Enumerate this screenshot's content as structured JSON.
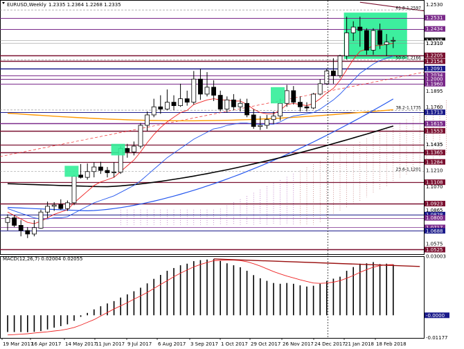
{
  "header": {
    "symbol_text": "EURUSD,Weekly",
    "ohlc_text": "1.2335 1.2364 1.2268 1.2335"
  },
  "colors": {
    "background": "#ffffff",
    "candle_up": "#ffffff",
    "candle_down": "#000000",
    "highlight_box": "#33ee99",
    "ema_red": "#ee2222",
    "ema_blue": "#2255ee",
    "ema_black": "#000000",
    "ema_orange": "#ff9900",
    "level_dark": "#7a1030",
    "level_purple": "#7a2a8a",
    "level_navy": "#1a1a8a",
    "level_gray": "#888888",
    "ichimoku_red": "#b05050",
    "ichimoku_purple": "#9a3aaa",
    "macd_signal": "#ee2222",
    "macd_trendline": "#9a1010",
    "current_tag": "#111111"
  },
  "chart_data": [
    {
      "type": "candlestick",
      "title": "EURUSD,Weekly",
      "ylim": [
        1.048,
        1.266
      ],
      "price_axis_ticks": [
        "1.2530",
        "1.2310",
        "1.1895",
        "1.1760",
        "1.1435",
        "1.1210",
        "1.1070",
        "1.0865",
        "1.0575"
      ],
      "date_labels": [
        "19 Mar 2017",
        "16 Apr 2017",
        "14 May 2017",
        "11 Jun 2017",
        "9 Jul 2017",
        "6 Aug 2017",
        "3 Sep 2017",
        "1 Oct 2017",
        "29 Oct 2017",
        "26 Nov 2017",
        "24 Dec 2017",
        "21 Jan 2018",
        "18 Feb 2018"
      ],
      "candles": [
        {
          "o": 1.076,
          "h": 1.083,
          "l": 1.069,
          "c": 1.08
        },
        {
          "o": 1.08,
          "h": 1.082,
          "l": 1.072,
          "c": 1.0735
        },
        {
          "o": 1.0735,
          "h": 1.078,
          "l": 1.064,
          "c": 1.069
        },
        {
          "o": 1.069,
          "h": 1.072,
          "l": 1.0625,
          "c": 1.066
        },
        {
          "o": 1.066,
          "h": 1.078,
          "l": 1.064,
          "c": 1.0715
        },
        {
          "o": 1.071,
          "h": 1.087,
          "l": 1.0705,
          "c": 1.085
        },
        {
          "o": 1.085,
          "h": 1.094,
          "l": 1.08,
          "c": 1.09
        },
        {
          "o": 1.09,
          "h": 1.0935,
          "l": 1.086,
          "c": 1.091
        },
        {
          "o": 1.0915,
          "h": 1.096,
          "l": 1.087,
          "c": 1.088
        },
        {
          "o": 1.088,
          "h": 1.095,
          "l": 1.086,
          "c": 1.093
        },
        {
          "o": 1.093,
          "h": 1.117,
          "l": 1.091,
          "c": 1.116
        },
        {
          "o": 1.117,
          "h": 1.1265,
          "l": 1.114,
          "c": 1.115
        },
        {
          "o": 1.115,
          "h": 1.127,
          "l": 1.113,
          "c": 1.12
        },
        {
          "o": 1.12,
          "h": 1.128,
          "l": 1.115,
          "c": 1.124
        },
        {
          "o": 1.124,
          "h": 1.1285,
          "l": 1.118,
          "c": 1.121
        },
        {
          "o": 1.121,
          "h": 1.124,
          "l": 1.115,
          "c": 1.119
        },
        {
          "o": 1.119,
          "h": 1.128,
          "l": 1.115,
          "c": 1.1195
        },
        {
          "o": 1.1195,
          "h": 1.142,
          "l": 1.118,
          "c": 1.14
        },
        {
          "o": 1.14,
          "h": 1.144,
          "l": 1.132,
          "c": 1.137
        },
        {
          "o": 1.137,
          "h": 1.146,
          "l": 1.134,
          "c": 1.142
        },
        {
          "o": 1.142,
          "h": 1.162,
          "l": 1.14,
          "c": 1.16
        },
        {
          "o": 1.16,
          "h": 1.172,
          "l": 1.155,
          "c": 1.169
        },
        {
          "o": 1.169,
          "h": 1.183,
          "l": 1.167,
          "c": 1.176
        },
        {
          "o": 1.176,
          "h": 1.186,
          "l": 1.17,
          "c": 1.174
        },
        {
          "o": 1.174,
          "h": 1.191,
          "l": 1.173,
          "c": 1.18
        },
        {
          "o": 1.18,
          "h": 1.186,
          "l": 1.173,
          "c": 1.177
        },
        {
          "o": 1.177,
          "h": 1.196,
          "l": 1.176,
          "c": 1.183
        },
        {
          "o": 1.183,
          "h": 1.19,
          "l": 1.177,
          "c": 1.18
        },
        {
          "o": 1.18,
          "h": 1.207,
          "l": 1.178,
          "c": 1.2
        },
        {
          "o": 1.2,
          "h": 1.209,
          "l": 1.182,
          "c": 1.187
        },
        {
          "o": 1.187,
          "h": 1.206,
          "l": 1.185,
          "c": 1.193
        },
        {
          "o": 1.193,
          "h": 1.199,
          "l": 1.181,
          "c": 1.186
        },
        {
          "o": 1.186,
          "h": 1.19,
          "l": 1.172,
          "c": 1.174
        },
        {
          "o": 1.174,
          "h": 1.185,
          "l": 1.171,
          "c": 1.182
        },
        {
          "o": 1.182,
          "h": 1.187,
          "l": 1.173,
          "c": 1.176
        },
        {
          "o": 1.176,
          "h": 1.183,
          "l": 1.172,
          "c": 1.179
        },
        {
          "o": 1.179,
          "h": 1.183,
          "l": 1.167,
          "c": 1.169
        },
        {
          "o": 1.169,
          "h": 1.174,
          "l": 1.157,
          "c": 1.159
        },
        {
          "o": 1.159,
          "h": 1.168,
          "l": 1.156,
          "c": 1.16
        },
        {
          "o": 1.16,
          "h": 1.169,
          "l": 1.157,
          "c": 1.165
        },
        {
          "o": 1.165,
          "h": 1.172,
          "l": 1.161,
          "c": 1.168
        },
        {
          "o": 1.168,
          "h": 1.183,
          "l": 1.164,
          "c": 1.179
        },
        {
          "o": 1.179,
          "h": 1.195,
          "l": 1.176,
          "c": 1.19
        },
        {
          "o": 1.19,
          "h": 1.194,
          "l": 1.178,
          "c": 1.18
        },
        {
          "o": 1.18,
          "h": 1.185,
          "l": 1.172,
          "c": 1.176
        },
        {
          "o": 1.176,
          "h": 1.18,
          "l": 1.172,
          "c": 1.175
        },
        {
          "o": 1.175,
          "h": 1.188,
          "l": 1.174,
          "c": 1.187
        },
        {
          "o": 1.187,
          "h": 1.2,
          "l": 1.186,
          "c": 1.196
        },
        {
          "o": 1.196,
          "h": 1.209,
          "l": 1.195,
          "c": 1.207
        },
        {
          "o": 1.207,
          "h": 1.218,
          "l": 1.196,
          "c": 1.203
        },
        {
          "o": 1.203,
          "h": 1.221,
          "l": 1.201,
          "c": 1.22
        },
        {
          "o": 1.22,
          "h": 1.254,
          "l": 1.217,
          "c": 1.24
        },
        {
          "o": 1.24,
          "h": 1.25,
          "l": 1.233,
          "c": 1.245
        },
        {
          "o": 1.245,
          "h": 1.254,
          "l": 1.228,
          "c": 1.242
        },
        {
          "o": 1.242,
          "h": 1.244,
          "l": 1.221,
          "c": 1.225
        },
        {
          "o": 1.225,
          "h": 1.244,
          "l": 1.221,
          "c": 1.242
        },
        {
          "o": 1.242,
          "h": 1.248,
          "l": 1.226,
          "c": 1.23
        },
        {
          "o": 1.23,
          "h": 1.239,
          "l": 1.22,
          "c": 1.232
        },
        {
          "o": 1.2335,
          "h": 1.2364,
          "l": 1.2268,
          "c": 1.2335
        }
      ],
      "ema_red": [
        1.085,
        1.082,
        1.079,
        1.076,
        1.075,
        1.077,
        1.08,
        1.083,
        1.085,
        1.087,
        1.093,
        1.098,
        1.103,
        1.108,
        1.111,
        1.113,
        1.115,
        1.12,
        1.125,
        1.13,
        1.137,
        1.145,
        1.152,
        1.158,
        1.163,
        1.167,
        1.171,
        1.173,
        1.178,
        1.18,
        1.182,
        1.183,
        1.182,
        1.182,
        1.181,
        1.181,
        1.178,
        1.174,
        1.171,
        1.17,
        1.17,
        1.173,
        1.178,
        1.179,
        1.178,
        1.177,
        1.179,
        1.183,
        1.188,
        1.192,
        1.199,
        1.208,
        1.217,
        1.224,
        1.226,
        1.229,
        1.229,
        1.23,
        1.231
      ],
      "ema_blue": [
        1.088,
        1.086,
        1.084,
        1.082,
        1.08,
        1.079,
        1.079,
        1.08,
        1.08,
        1.081,
        1.084,
        1.087,
        1.09,
        1.093,
        1.095,
        1.097,
        1.099,
        1.102,
        1.105,
        1.108,
        1.112,
        1.117,
        1.122,
        1.127,
        1.132,
        1.136,
        1.14,
        1.144,
        1.148,
        1.151,
        1.154,
        1.157,
        1.158,
        1.16,
        1.161,
        1.162,
        1.162,
        1.161,
        1.161,
        1.161,
        1.161,
        1.163,
        1.166,
        1.168,
        1.169,
        1.17,
        1.171,
        1.174,
        1.178,
        1.182,
        1.187,
        1.193,
        1.199,
        1.205,
        1.209,
        1.213,
        1.216,
        1.218,
        1.22
      ],
      "ichimoku_cloud": "dotted cloud band beneath price, Sep 2017 → Mar 2018",
      "horizontal_levels": [
        "1.2531",
        "1.2434",
        "1.2335",
        "1.2310",
        "1.2205",
        "1.2154",
        "1.2091",
        "1.2034",
        "1.2000",
        "1.1960",
        "1.1713",
        "1.1615",
        "1.1553",
        "1.1435",
        "1.1365",
        "1.1284",
        "1.1108",
        "1.0923",
        "1.0828",
        "1.0800",
        "1.0717",
        "1.0688",
        "1.0525"
      ],
      "annotations": [
        "61.8-1.2597",
        "50.0-1.2166",
        "38.2-1.1735",
        "23.6-1.1201"
      ]
    },
    {
      "type": "bar",
      "title": "MACD(12,26,7) 0.02004 0.02055",
      "ylim": [
        -0.0115,
        0.03
      ],
      "axis_ticks": [
        "0.03003",
        "0.00000",
        "-0.01177"
      ],
      "histogram": [
        -0.0085,
        -0.0085,
        -0.0085,
        -0.0086,
        -0.0084,
        -0.008,
        -0.0072,
        -0.0063,
        -0.0055,
        -0.0046,
        -0.0028,
        -0.0008,
        0.0012,
        0.003,
        0.0046,
        0.006,
        0.0072,
        0.009,
        0.0106,
        0.0122,
        0.014,
        0.0162,
        0.0185,
        0.0205,
        0.0226,
        0.024,
        0.0254,
        0.0262,
        0.0275,
        0.028,
        0.0283,
        0.0285,
        0.0276,
        0.0264,
        0.0254,
        0.0244,
        0.0226,
        0.0204,
        0.0188,
        0.0175,
        0.0164,
        0.016,
        0.0164,
        0.016,
        0.0152,
        0.0146,
        0.015,
        0.016,
        0.0175,
        0.0186,
        0.0196,
        0.0226,
        0.0245,
        0.0262,
        0.0264,
        0.027,
        0.026,
        0.0262,
        0.0258
      ],
      "signal": [
        -0.01,
        -0.0098,
        -0.0096,
        -0.0094,
        -0.009,
        -0.0087,
        -0.0084,
        -0.008,
        -0.0076,
        -0.007,
        -0.0062,
        -0.005,
        -0.0036,
        -0.0022,
        -0.0004,
        0.0014,
        0.0032,
        0.0048,
        0.0064,
        0.0082,
        0.0098,
        0.0116,
        0.0136,
        0.0156,
        0.0176,
        0.0196,
        0.0214,
        0.023,
        0.0246,
        0.0258,
        0.0268,
        0.0277,
        0.0279,
        0.028,
        0.028,
        0.0278,
        0.0272,
        0.0262,
        0.025,
        0.0236,
        0.0222,
        0.021,
        0.0199,
        0.019,
        0.018,
        0.0172,
        0.0164,
        0.0162,
        0.0164,
        0.0168,
        0.0176,
        0.0188,
        0.0202,
        0.0218,
        0.0232,
        0.0244,
        0.0252,
        0.0256,
        0.0258
      ]
    }
  ]
}
